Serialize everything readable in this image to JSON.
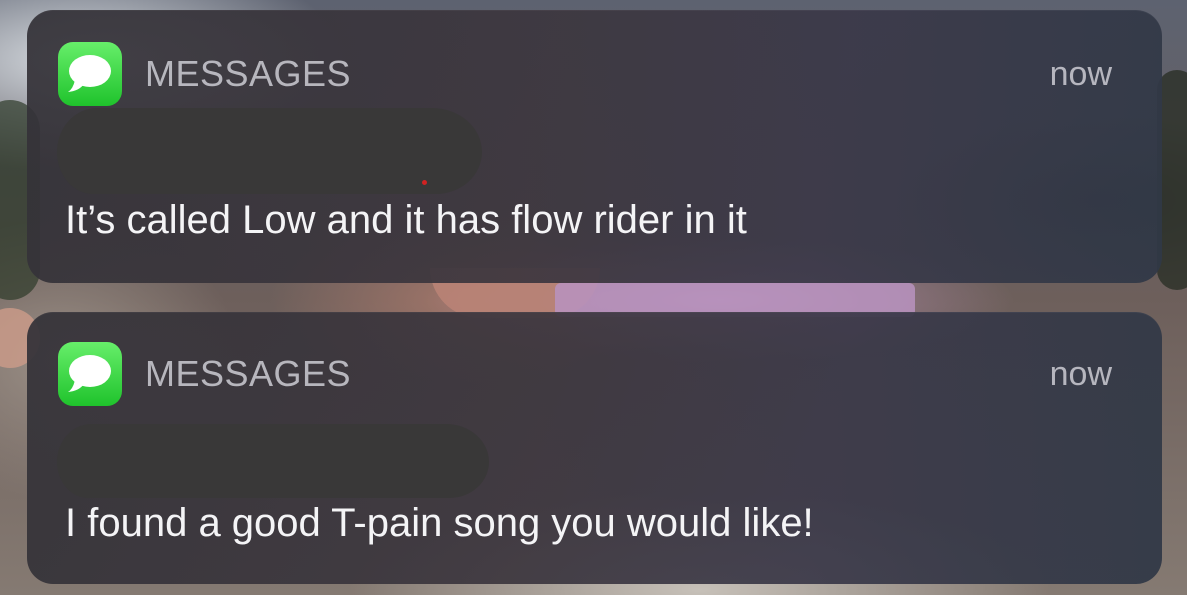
{
  "notifications": [
    {
      "app_name": "MESSAGES",
      "app_icon": "messages-icon",
      "time": "now",
      "sender": "",
      "body": "It’s called Low and it has flow rider in it"
    },
    {
      "app_name": "MESSAGES",
      "app_icon": "messages-icon",
      "time": "now",
      "sender": "",
      "body": "I found a good T-pain song you would like!"
    }
  ],
  "colors": {
    "icon_green": "#2ad03a",
    "redaction": "#393838",
    "body_text": "#f4f4f6",
    "meta_text": "#cdcdd4"
  }
}
